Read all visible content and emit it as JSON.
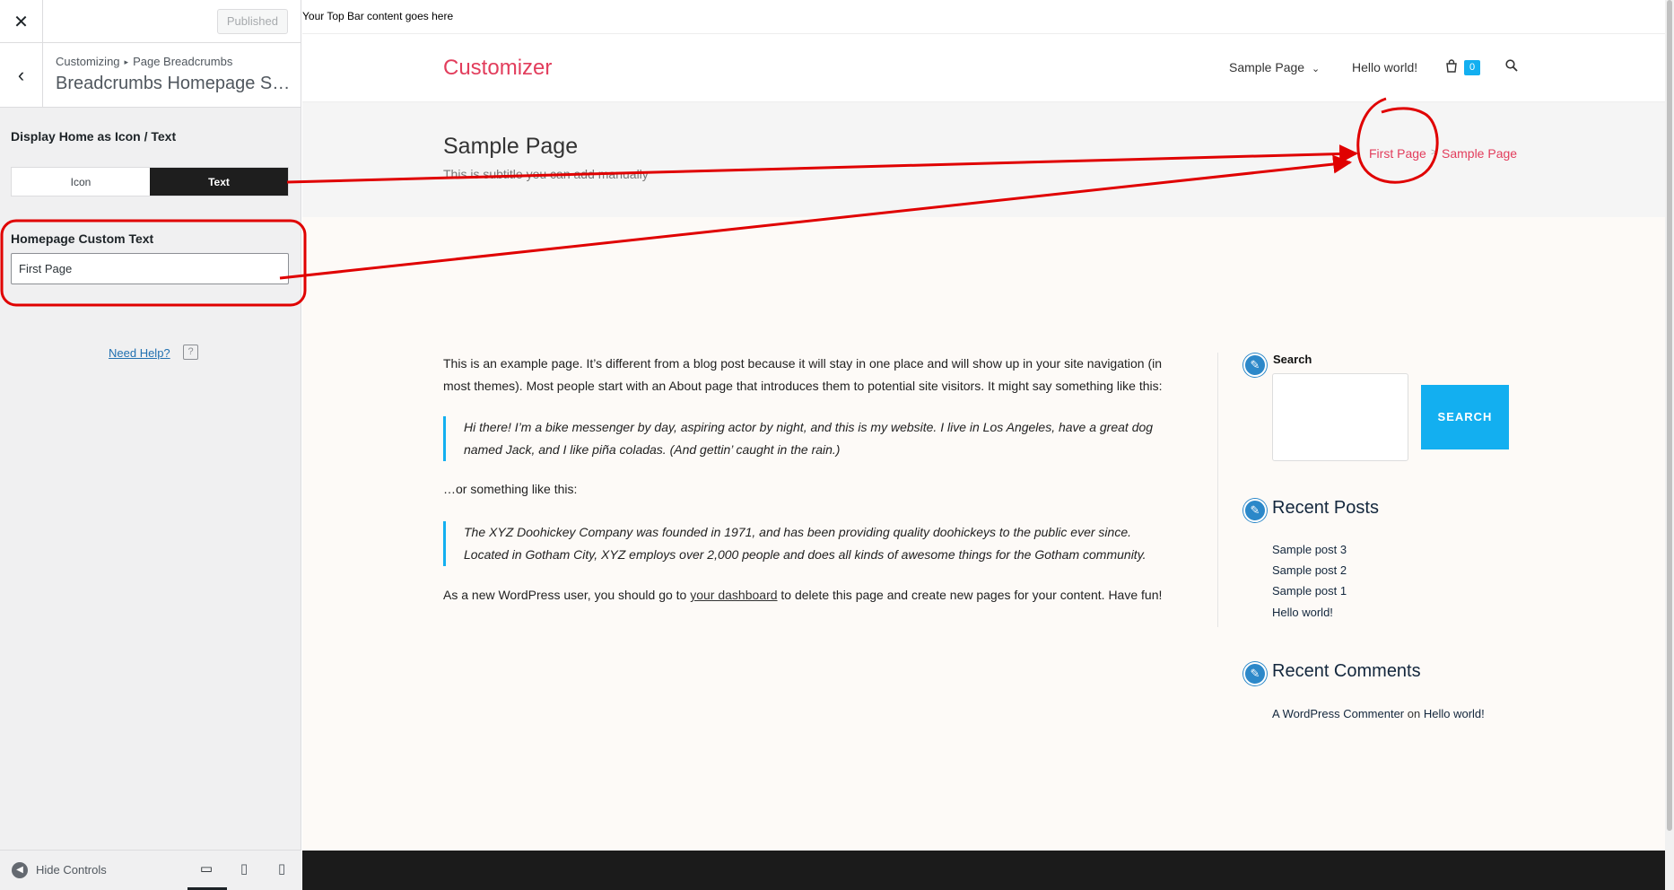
{
  "customizer": {
    "published_label": "Published",
    "breadcrumb": {
      "root": "Customizing",
      "section": "Page Breadcrumbs"
    },
    "section_title": "Breadcrumbs Homepage Settings",
    "display_home": {
      "label": "Display Home as Icon / Text",
      "options": [
        "Icon",
        "Text"
      ],
      "selected": "Text"
    },
    "homepage_text": {
      "label": "Homepage Custom Text",
      "value": "First Page"
    },
    "help_label": "Need Help?",
    "footer": {
      "hide_controls": "Hide Controls"
    }
  },
  "preview": {
    "topbar_text": "Your Top Bar content goes here",
    "site_title": "Customizer",
    "nav": [
      "Sample Page",
      "Hello world!"
    ],
    "cart_count": "0",
    "page_title": "Sample Page",
    "page_subtitle": "This is subtitle you can add manually",
    "breadcrumbs": {
      "home": "First Page",
      "separator": ">",
      "current": "Sample Page"
    },
    "content": {
      "p1": "This is an example page. It’s different from a blog post because it will stay in one place and will show up in your site navigation (in most themes). Most people start with an About page that introduces them to potential site visitors. It might say something like this:",
      "q1": "Hi there! I’m a bike messenger by day, aspiring actor by night, and this is my website. I live in Los Angeles, have a great dog named Jack, and I like piña coladas. (And gettin’ caught in the rain.)",
      "p2": "…or something like this:",
      "q2": "The XYZ Doohickey Company was founded in 1971, and has been providing quality doohickeys to the public ever since. Located in Gotham City, XYZ employs over 2,000 people and does all kinds of awesome things for the Gotham community.",
      "p3_before": "As a new WordPress user, you should go to ",
      "p3_link": "your dashboard",
      "p3_after": " to delete this page and create new pages for your content. Have fun!"
    },
    "sidebar": {
      "search_title": "Search",
      "search_button": "SEARCH",
      "recent_posts_title": "Recent Posts",
      "recent_posts": [
        "Sample post 3",
        "Sample post 2",
        "Sample post 1",
        "Hello world!"
      ],
      "recent_comments_title": "Recent Comments",
      "comment_author": "A WordPress Commenter",
      "comment_on": "on",
      "comment_post": "Hello world!"
    }
  },
  "icons": {
    "close": "close-icon",
    "back": "chevron-left-icon",
    "help": "question-icon",
    "cart": "shopping-bag-icon",
    "search": "search-icon",
    "widget": "pencil-icon",
    "devices": [
      "desktop-icon",
      "tablet-icon",
      "mobile-icon"
    ]
  },
  "colors": {
    "accent": "#e23d5c",
    "button": "#13aff0",
    "annotation": "#e00000"
  }
}
